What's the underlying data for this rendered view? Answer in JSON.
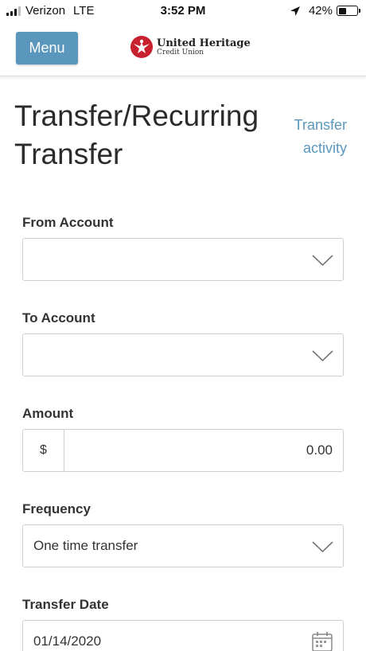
{
  "status_bar": {
    "carrier": "Verizon",
    "network": "LTE",
    "time": "3:52 PM",
    "battery_percent": "42%",
    "battery_level": 0.42
  },
  "header": {
    "menu_label": "Menu",
    "logo_name": "United Heritage",
    "logo_sub": "Credit Union",
    "brand_color": "#5b97bd",
    "logo_color": "#c8202f"
  },
  "page": {
    "title": "Transfer/Recurring Transfer",
    "activity_link": "Transfer activity"
  },
  "form": {
    "from_account": {
      "label": "From Account",
      "value": ""
    },
    "to_account": {
      "label": "To Account",
      "value": ""
    },
    "amount": {
      "label": "Amount",
      "currency_symbol": "$",
      "value": "0.00"
    },
    "frequency": {
      "label": "Frequency",
      "value": "One time transfer"
    },
    "transfer_date": {
      "label": "Transfer Date",
      "value": "01/14/2020"
    }
  },
  "icons": {
    "signal": "signal-icon",
    "location": "location-arrow-icon",
    "battery": "battery-icon",
    "logo": "eagle-logo-icon",
    "dropdown": "chevron-down-icon",
    "calendar": "calendar-icon"
  }
}
